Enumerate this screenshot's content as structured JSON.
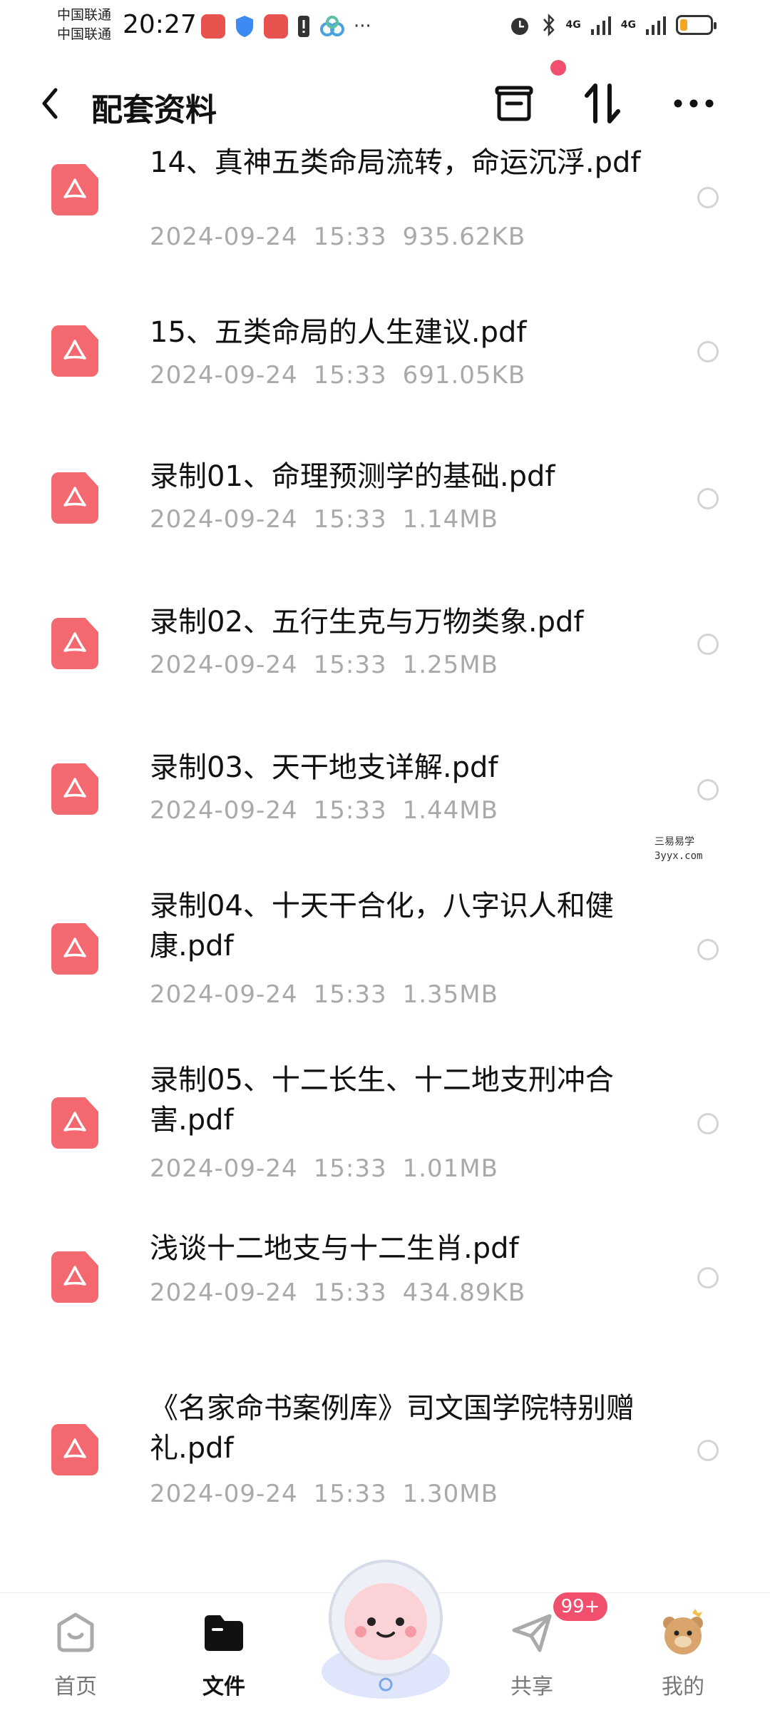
{
  "status_bar": {
    "carrier_1": "中国联通",
    "carrier_2": "中国联通",
    "time": "20:27",
    "network_1": "4G",
    "network_2": "4G"
  },
  "header": {
    "title": "配套资料"
  },
  "files": [
    {
      "name": "14、真神五类命局流转，命运沉浮.pdf",
      "date": "2024-09-24",
      "time": "15:33",
      "size": "935.62KB"
    },
    {
      "name": "15、五类命局的人生建议.pdf",
      "date": "2024-09-24",
      "time": "15:33",
      "size": "691.05KB"
    },
    {
      "name": "录制01、命理预测学的基础.pdf",
      "date": "2024-09-24",
      "time": "15:33",
      "size": "1.14MB"
    },
    {
      "name": "录制02、五行生克与万物类象.pdf",
      "date": "2024-09-24",
      "time": "15:33",
      "size": "1.25MB"
    },
    {
      "name": "录制03、天干地支详解.pdf",
      "date": "2024-09-24",
      "time": "15:33",
      "size": "1.44MB"
    },
    {
      "name": "录制04、十天干合化，八字识人和健康.pdf",
      "date": "2024-09-24",
      "time": "15:33",
      "size": "1.35MB"
    },
    {
      "name": "录制05、十二长生、十二地支刑冲合害.pdf",
      "date": "2024-09-24",
      "time": "15:33",
      "size": "1.01MB"
    },
    {
      "name": "浅谈十二地支与十二生肖.pdf",
      "date": "2024-09-24",
      "time": "15:33",
      "size": "434.89KB"
    },
    {
      "name": "《名家命书案例库》司文国学院特别赠礼.pdf",
      "date": "2024-09-24",
      "time": "15:33",
      "size": "1.30MB"
    }
  ],
  "watermark": {
    "line1": "三易易学",
    "line2": "3yyx.com"
  },
  "tabs": {
    "home": "首页",
    "files": "文件",
    "share": "共享",
    "mine": "我的",
    "share_badge": "99+"
  },
  "colors": {
    "pdf_icon": "#f4686f",
    "badge": "#f0506e",
    "meta_text": "#a9a9a9"
  }
}
